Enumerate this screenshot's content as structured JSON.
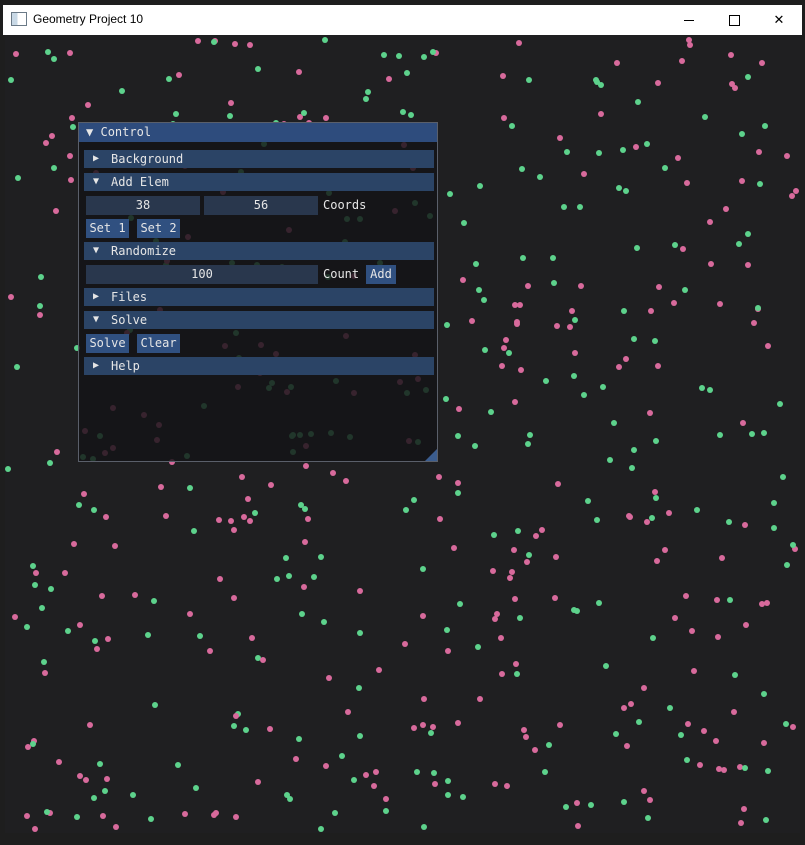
{
  "window": {
    "title": "Geometry Project 10",
    "min_symbol": "",
    "max_symbol": "",
    "close_symbol": "✕"
  },
  "colors": {
    "pink": "#d86a9c",
    "green": "#5dd28c",
    "background": "#1f1f21",
    "header": "#2b4466",
    "title": "#2e4c7d"
  },
  "panel": {
    "title": "Control",
    "title_arrow": "▼",
    "background": {
      "arrow": "▶",
      "label": "Background"
    },
    "add_elem": {
      "arrow": "▼",
      "label": "Add Elem",
      "x": "38",
      "y": "56",
      "coords_label": "Coords",
      "set1": "Set 1",
      "set2": "Set 2"
    },
    "randomize": {
      "arrow": "▼",
      "label": "Randomize",
      "count": "100",
      "count_label": "Count",
      "add": "Add"
    },
    "files": {
      "arrow": "▶",
      "label": "Files"
    },
    "solve": {
      "arrow": "▼",
      "label": "Solve",
      "solve_btn": "Solve",
      "clear_btn": "Clear"
    },
    "help": {
      "arrow": "▶",
      "label": "Help"
    }
  }
}
